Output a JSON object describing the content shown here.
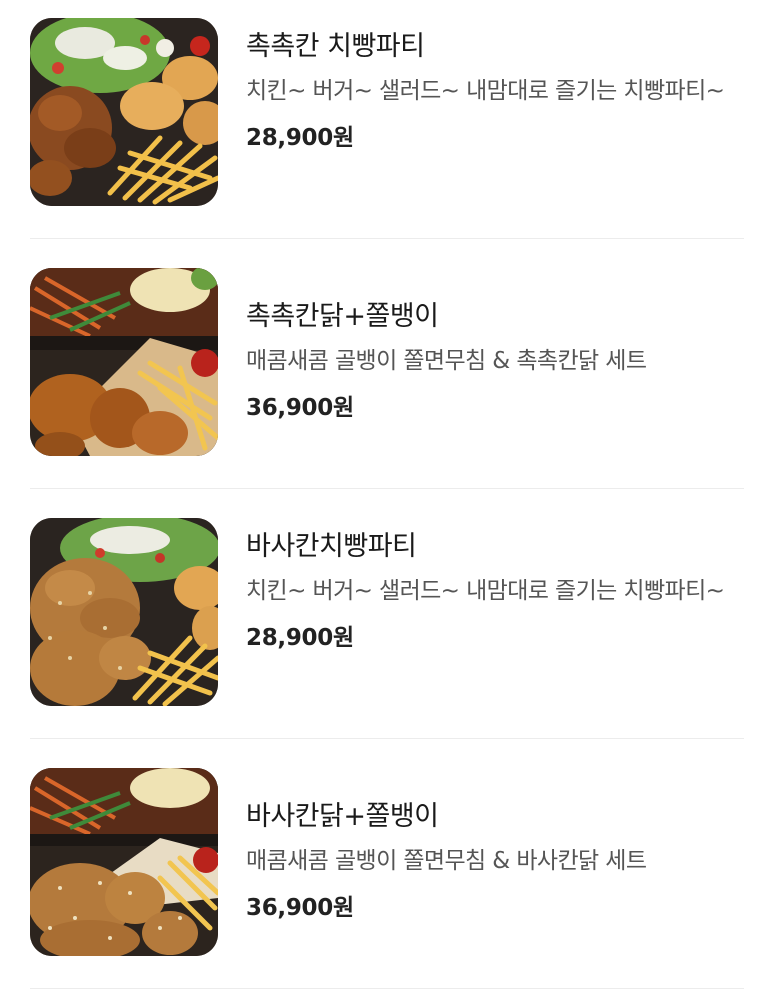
{
  "menu": {
    "items": [
      {
        "name": "촉촉칸 치빵파티",
        "description": "치킨~ 버거~ 샐러드~ 내맘대로 즐기는 치빵파티~",
        "price": "28,900원",
        "image": "chicken-burger-salad-fries-platter"
      },
      {
        "name": "촉촉칸닭+쫄뱅이",
        "description": "매콤새콤 골뱅이 쫄면무침 & 촉촉칸닭 세트",
        "price": "36,900원",
        "image": "chicken-fries-spicy-noodle-platter"
      },
      {
        "name": "바사칸치빵파티",
        "description": "치킨~ 버거~ 샐러드~ 내맘대로 즐기는 치빵파티~",
        "price": "28,900원",
        "image": "crispy-chicken-burger-salad-fries-platter"
      },
      {
        "name": "바사칸닭+쫄뱅이",
        "description": "매콤새콤 골뱅이 쫄면무침 & 바사칸닭 세트",
        "price": "36,900원",
        "image": "crispy-chicken-spicy-noodle-platter"
      }
    ]
  },
  "colors": {
    "text_primary": "#1a1a1a",
    "text_secondary": "#555555",
    "divider": "#ececec"
  }
}
